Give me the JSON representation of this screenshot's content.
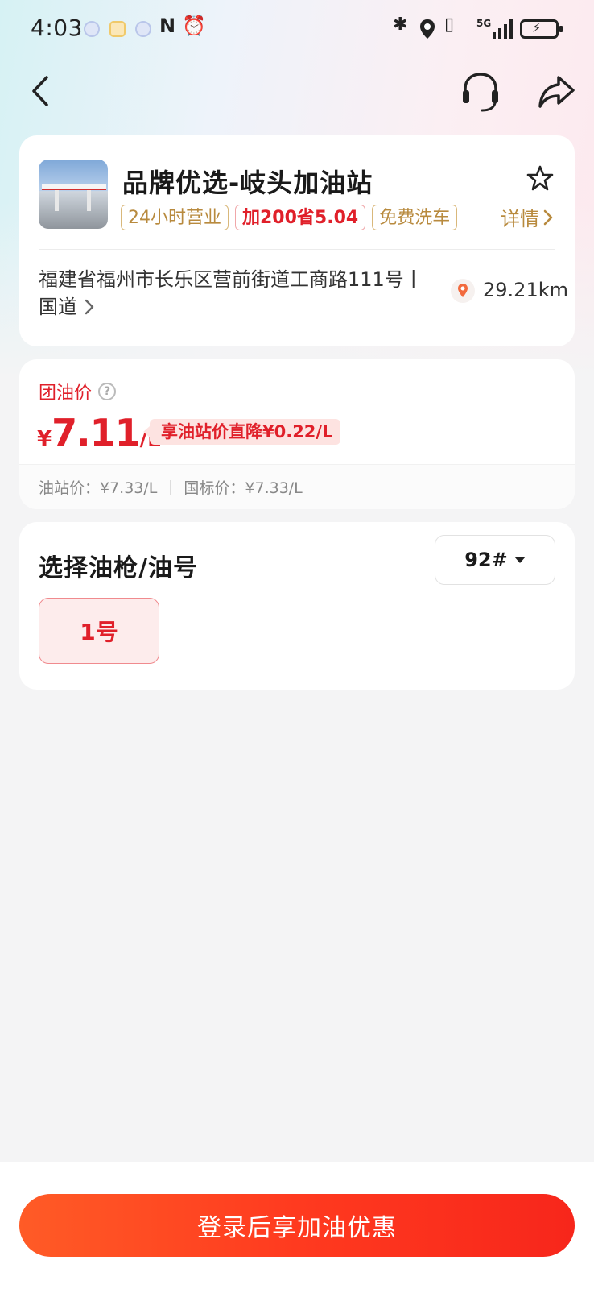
{
  "status_bar": {
    "time": "4:03",
    "network": "5G"
  },
  "nav": {
    "back_icon": "chevron-left-icon",
    "service_icon": "headset-icon",
    "share_icon": "share-arrow-icon"
  },
  "station": {
    "name": "品牌优选-岐头加油站",
    "tags": [
      "24小时营业",
      "加200省5.04",
      "免费洗车"
    ],
    "detail_label": "详情",
    "address": "福建省福州市长乐区营前街道工商路111号丨国道",
    "distance": "29.21km"
  },
  "price": {
    "label": "团油价",
    "currency": "¥",
    "value": "7.11",
    "unit": "/L",
    "promo": "享油站价直降¥0.22/L",
    "station_price": "油站价：¥7.33/L",
    "national_price": "国标价：¥7.33/L"
  },
  "fuel": {
    "title": "选择油枪/油号",
    "selected_grade": "92#",
    "guns": [
      "1号"
    ]
  },
  "footer": {
    "cta": "登录后享加油优惠"
  },
  "colors": {
    "accent_red": "#e0202a",
    "gold": "#b88a3e",
    "cta_orange": "#ff3a1f"
  }
}
